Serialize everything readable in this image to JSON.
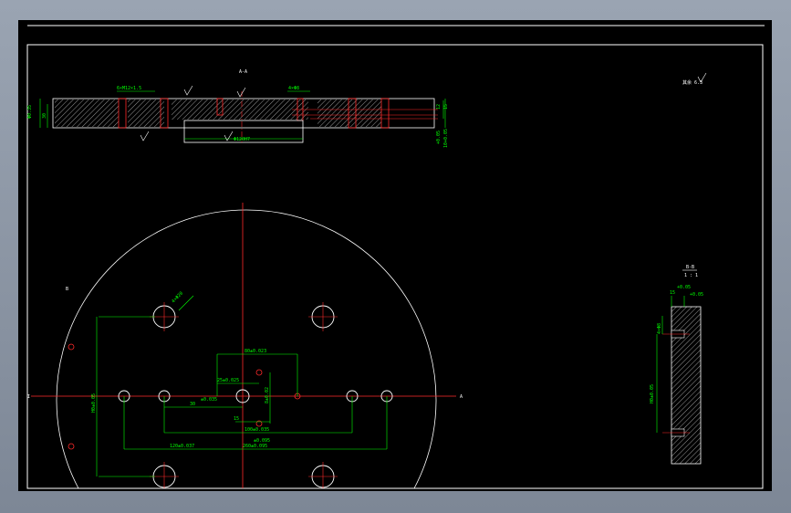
{
  "colors": {
    "background": "#000000",
    "outline": "#ffffff",
    "centerline": "#ff2a2a",
    "dimension": "#00ff00",
    "hatch": "#ffffff"
  },
  "top_view": {
    "title": "A-A",
    "dims": {
      "thread": "6×M12×1.5",
      "holes": "4×Φ8",
      "left_height": "Φ0.35",
      "left_thk": "30",
      "bore": "Φ120H7",
      "right_1": "12",
      "right_2": "15",
      "right_3": "+0.05",
      "right_4": "10+0.05"
    },
    "roughness": "6.3"
  },
  "roughness_note": "其余 6.3",
  "plan_view": {
    "section_left": "I",
    "section_right": "A",
    "section_b": "B",
    "dims": {
      "hole_label": "4×Φ20",
      "d80": "80±0.023",
      "d25": "25±0.025",
      "d30": "30",
      "d30tol": "±0.035",
      "d15": "15",
      "d100": "100±0.035",
      "d120": "120±0.037",
      "d260": "260±0.095",
      "d260tol": "±0.095",
      "vert": "H0±0.05",
      "small": "8±0.02"
    }
  },
  "section_view": {
    "title": "B-B",
    "scale": "1 : 1",
    "dims": {
      "top1": "15",
      "top2": "+0.05",
      "top3": "+0.05",
      "side1": "4×Φ8",
      "side2": "H0±0.05"
    }
  }
}
